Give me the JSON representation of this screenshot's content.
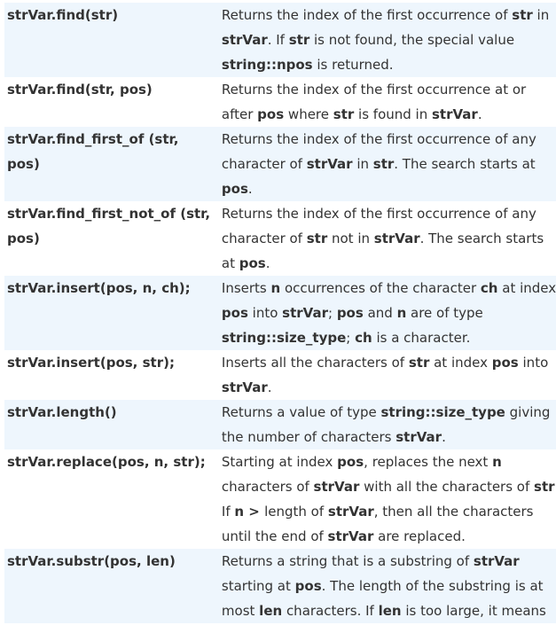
{
  "rows": [
    {
      "signature": "strVar.find(str)",
      "description": [
        {
          "t": "Returns the index of the first occurrence of "
        },
        {
          "t": "str",
          "b": true
        },
        {
          "t": " in "
        },
        {
          "t": "strVar",
          "b": true
        },
        {
          "t": ". If "
        },
        {
          "t": "str",
          "b": true
        },
        {
          "t": " is not found, the special value "
        },
        {
          "t": "string::npos",
          "b": true
        },
        {
          "t": " is returned."
        }
      ]
    },
    {
      "signature": "strVar.find(str, pos)",
      "description": [
        {
          "t": "Returns the index of the first occurrence at or after "
        },
        {
          "t": "pos",
          "b": true
        },
        {
          "t": " where "
        },
        {
          "t": "str",
          "b": true
        },
        {
          "t": " is found in "
        },
        {
          "t": "strVar",
          "b": true
        },
        {
          "t": "."
        }
      ]
    },
    {
      "signature": "strVar.find_first_of (str, pos)",
      "description": [
        {
          "t": "Returns the index of the first occurrence of any character of "
        },
        {
          "t": "strVar",
          "b": true
        },
        {
          "t": " in "
        },
        {
          "t": "str",
          "b": true
        },
        {
          "t": ". The search starts at "
        },
        {
          "t": "pos",
          "b": true
        },
        {
          "t": "."
        }
      ]
    },
    {
      "signature": "strVar.find_first_not_of (str, pos)",
      "description": [
        {
          "t": "Returns the index of the first occurrence of any character of "
        },
        {
          "t": "str",
          "b": true
        },
        {
          "t": " not in "
        },
        {
          "t": "strVar",
          "b": true
        },
        {
          "t": ". The search starts at "
        },
        {
          "t": "pos",
          "b": true
        },
        {
          "t": "."
        }
      ]
    },
    {
      "signature": "strVar.insert(pos, n, ch);",
      "description": [
        {
          "t": "Inserts "
        },
        {
          "t": "n",
          "b": true
        },
        {
          "t": " occurrences of the character "
        },
        {
          "t": "ch",
          "b": true
        },
        {
          "t": " at index "
        },
        {
          "t": "pos",
          "b": true
        },
        {
          "t": " into "
        },
        {
          "t": "strVar",
          "b": true
        },
        {
          "t": "; "
        },
        {
          "t": "pos",
          "b": true
        },
        {
          "t": " and "
        },
        {
          "t": "n",
          "b": true
        },
        {
          "t": " are of type "
        },
        {
          "t": "string::size_type",
          "b": true
        },
        {
          "t": "; "
        },
        {
          "t": "ch",
          "b": true
        },
        {
          "t": " is a character."
        }
      ]
    },
    {
      "signature": "strVar.insert(pos, str);",
      "description": [
        {
          "t": "Inserts all the characters of "
        },
        {
          "t": "str",
          "b": true
        },
        {
          "t": " at index "
        },
        {
          "t": "pos",
          "b": true
        },
        {
          "t": " into "
        },
        {
          "t": "strVar",
          "b": true
        },
        {
          "t": "."
        }
      ]
    },
    {
      "signature": "strVar.length()",
      "description": [
        {
          "t": "Returns a value of type "
        },
        {
          "t": "string::size_type",
          "b": true
        },
        {
          "t": " giving the number of characters "
        },
        {
          "t": "strVar",
          "b": true
        },
        {
          "t": "."
        }
      ]
    },
    {
      "signature": "strVar.replace(pos, n, str);",
      "description": [
        {
          "t": "Starting at index "
        },
        {
          "t": "pos",
          "b": true
        },
        {
          "t": ", replaces the next "
        },
        {
          "t": "n",
          "b": true
        },
        {
          "t": " characters of "
        },
        {
          "t": "strVar",
          "b": true
        },
        {
          "t": " with all the characters of "
        },
        {
          "t": "str",
          "b": true
        },
        {
          "t": ". If "
        },
        {
          "t": "n > ",
          "b": true
        },
        {
          "t": "length of "
        },
        {
          "t": "strVar",
          "b": true
        },
        {
          "t": ", then all the characters until the end of "
        },
        {
          "t": "strVar",
          "b": true
        },
        {
          "t": " are replaced."
        }
      ]
    },
    {
      "signature": "strVar.substr(pos, len)",
      "description": [
        {
          "t": "Returns a string that is a substring of "
        },
        {
          "t": "strVar",
          "b": true
        },
        {
          "t": " starting at "
        },
        {
          "t": "pos",
          "b": true
        },
        {
          "t": ". The length of the substring is at most "
        },
        {
          "t": "len",
          "b": true
        },
        {
          "t": " characters. If "
        },
        {
          "t": "len",
          "b": true
        },
        {
          "t": " is too large, it means"
        }
      ]
    }
  ]
}
